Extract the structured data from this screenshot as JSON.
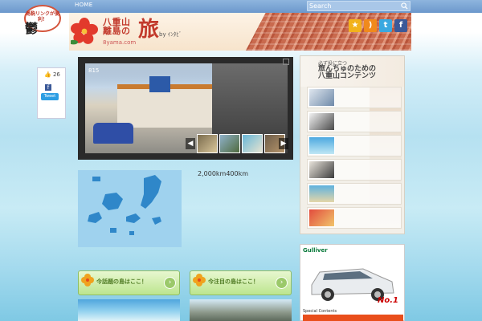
{
  "topbar": {
    "home_label": "HOME",
    "search_placeholder": "Search"
  },
  "header": {
    "bubble_text": "島駒リンクが便利！",
    "bubble_char": "鬱",
    "logo_small": "八重山",
    "logo_small2": "離島の",
    "logo_big": "旅",
    "logo_url": "8yama.com",
    "logo_by": "by ｲﾝﾀﾋﾞ",
    "social_icons": [
      "bookmark-star-icon",
      "rss-icon",
      "twitter-icon",
      "facebook-icon"
    ],
    "social_colors": [
      "#f2b21b",
      "#f08a1c",
      "#3aa8e0",
      "#3b5998"
    ]
  },
  "share": {
    "like_count": "26",
    "tweet_label": "Tweet"
  },
  "slider": {
    "slide_label": "815"
  },
  "main": {
    "intro_text": "2,000km400km"
  },
  "promos": [
    {
      "label": "今話題の島はここ！"
    },
    {
      "label": "今注目の島はここ！"
    }
  ],
  "right_panel": {
    "title_small": "必ず役に立つ",
    "title_line1": "旅んちゅのための",
    "title_line2": "八重山コンテンツ"
  },
  "ad": {
    "brand": "Gulliver",
    "badge": "No.1",
    "special": "Special Contents"
  },
  "colors": {
    "topbar": "#7aa4d4",
    "logo_red": "#c2392b",
    "promo_green": "#bce58e"
  }
}
